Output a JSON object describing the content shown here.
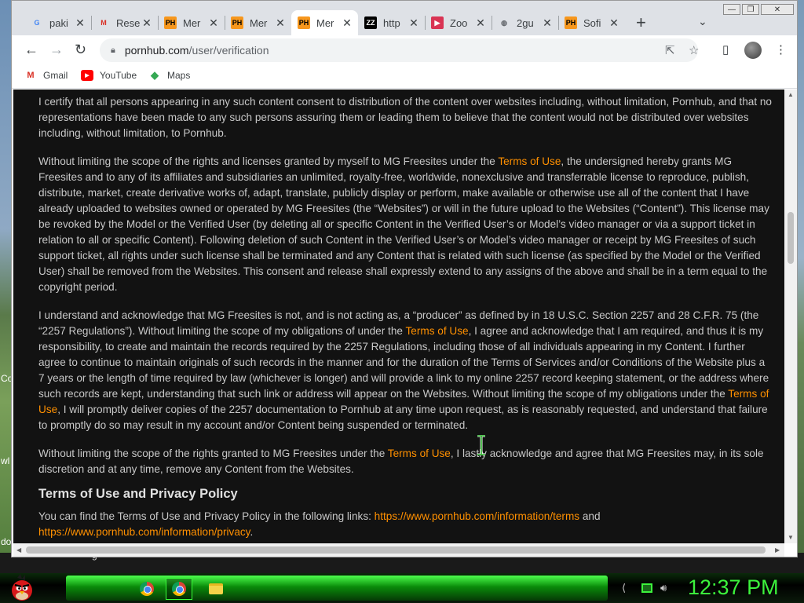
{
  "tabs": [
    {
      "title": "paki",
      "favicon": "google-icon"
    },
    {
      "title": "Rese",
      "favicon": "gmail-icon"
    },
    {
      "title": "Mer",
      "favicon": "ph-icon"
    },
    {
      "title": "Mer",
      "favicon": "ph-icon"
    },
    {
      "title": "Mer",
      "favicon": "ph-icon",
      "active": true
    },
    {
      "title": "http",
      "favicon": "zz-icon"
    },
    {
      "title": "Zoo",
      "favicon": "video-icon"
    },
    {
      "title": "2gu",
      "favicon": "globe-icon"
    },
    {
      "title": "Sofi",
      "favicon": "ph-icon"
    }
  ],
  "favicon_text": {
    "ph": "PH",
    "zz": "ZZ"
  },
  "address_bar": {
    "host": "pornhub.com",
    "path": "/user/verification"
  },
  "bookmarks": [
    {
      "label": "Gmail",
      "icon": "gmail-icon"
    },
    {
      "label": "YouTube",
      "icon": "youtube-icon"
    },
    {
      "label": "Maps",
      "icon": "maps-icon"
    }
  ],
  "content": {
    "p1": "I certify that all persons appearing in any such content consent to distribution of the content over websites including, without limitation, Pornhub, and that no representations have been made to any such persons assuring them or leading them to believe that the content would not be distributed over websites including, without limitation, to Pornhub.",
    "p2a": "Without limiting the scope of the rights and licenses granted by myself to MG Freesites under the ",
    "p2link": "Terms of Use",
    "p2b": ", the undersigned hereby grants MG Freesites and to any of its affiliates and subsidiaries an unlimited, royalty-free, worldwide, nonexclusive and transferrable license to reproduce, publish, distribute, market, create derivative works of, adapt, translate, publicly display or perform, make available or otherwise use all of the content that I have already uploaded to websites owned or operated by MG Freesites (the “Websites”) or will in the future upload to the Websites (“Content”). This license may be revoked by the Model or the Verified User (by deleting all or specific Content in the Verified User’s or Model’s video manager or via a support ticket in relation to all or specific Content). Following deletion of such Content in the Verified User’s or Model’s video manager or receipt by MG Freesites of such support ticket, all rights under such license shall be terminated and any Content that is related with such license (as specified by the Model or the Verified User) shall be removed from the Websites. This consent and release shall expressly extend to any assigns of the above and shall be in a term equal to the copyright period.",
    "p3a": "I understand and acknowledge that MG Freesites is not, and is not acting as, a “producer” as defined by in 18 U.S.C. Section 2257 and 28 C.F.R. 75 (the “2257 Regulations”). Without limiting the scope of my obligations of under the ",
    "p3link1": "Terms of Use",
    "p3b": ", I agree and acknowledge that I am required, and thus it is my responsibility, to create and maintain the records required by the 2257 Regulations, including those of all individuals appearing in my Content. I further agree to continue to maintain originals of such records in the manner and for the duration of the Terms of Services and/or Conditions of the Website plus a 7 years or the length of time required by law (whichever is longer) and will provide a link to my online 2257 record keeping statement, or the address where such records are kept, understanding that such link or address will appear on the Websites. Without limiting the scope of my obligations under the ",
    "p3link2": "Terms of Use",
    "p3c": ", I will promptly deliver copies of the 2257 documentation to Pornhub at any time upon request, as is reasonably requested, and understand that failure to promptly do so may result in my account and/or Content being suspended or terminated.",
    "p4a": "Without limiting the scope of the rights granted to MG Freesites under the ",
    "p4link": "Terms of Use",
    "p4b": ", I lastly acknowledge and agree that MG Freesites may, in its sole discretion and at any time, remove any Content from the Websites.",
    "heading": "Terms of Use and Privacy Policy",
    "p5a": "You can find the Terms of Use and Privacy Policy in the following links: ",
    "p5link1": "https://www.pornhub.com/information/terms",
    "p5b": " and ",
    "p5link2": "https://www.pornhub.com/information/privacy",
    "p5c": "."
  },
  "desktop_fragments": {
    "left1": "Co",
    "left2": "wl",
    "left3": "do",
    "bottom": "g"
  },
  "taskbar": {
    "clock": "12:37 PM"
  },
  "colors": {
    "link": "#ff9000",
    "page_bg": "#121212",
    "clock": "#3cf23c"
  }
}
